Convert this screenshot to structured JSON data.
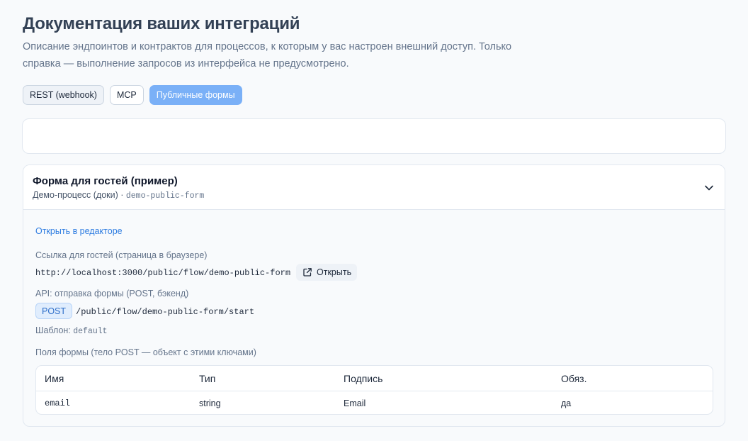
{
  "page": {
    "title": "Документация ваших интеграций",
    "description": "Описание эндпоинтов и контрактов для процессов, к которым у вас настроен внешний доступ. Только справка — выполнение запросов из интерфейса не предусмотрено."
  },
  "tabs": [
    {
      "label": "REST (webhook)",
      "state": "soft"
    },
    {
      "label": "MCP",
      "state": "default"
    },
    {
      "label": "Публичные формы",
      "state": "active"
    }
  ],
  "form": {
    "title": "Форма для гостей (пример)",
    "process_name": "Демо-процесс (доки)",
    "separator": " · ",
    "slug": "demo-public-form",
    "open_in_editor": "Открыть в редакторе",
    "guest_link_label": "Ссылка для гостей (страница в браузере)",
    "guest_url": "http://localhost:3000/public/flow/demo-public-form",
    "open_button": "Открыть",
    "api_label": "API: отправка формы (POST, бэкенд)",
    "method": "POST",
    "api_path": "/public/flow/demo-public-form/start",
    "template_label": "Шаблон: ",
    "template_value": "default",
    "fields_label": "Поля формы (тело POST — объект с этими ключами)",
    "table": {
      "headers": [
        "Имя",
        "Тип",
        "Подпись",
        "Обяз."
      ],
      "rows": [
        [
          "email",
          "string",
          "Email",
          "да"
        ]
      ]
    }
  },
  "colors": {
    "accent": "#7ab0f7",
    "link": "#2f7de1",
    "background": "#f8fafc"
  },
  "icons": {
    "expand": "chevron-down-icon",
    "external": "external-link-icon"
  }
}
